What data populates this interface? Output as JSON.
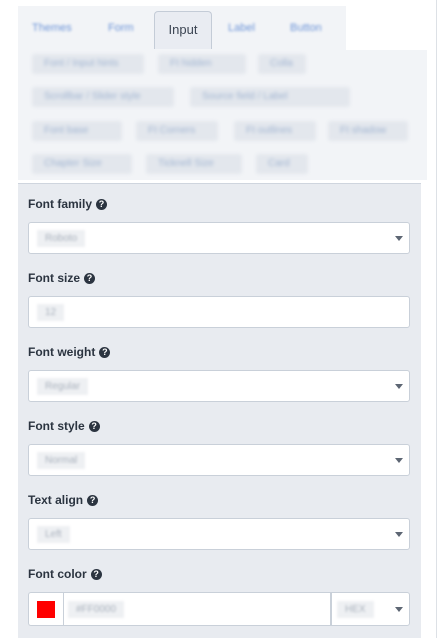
{
  "tabs": [
    {
      "label": "Themes"
    },
    {
      "label": "Form"
    },
    {
      "label": "Input"
    },
    {
      "label": "Label"
    },
    {
      "label": "Button"
    }
  ],
  "property_chips": [
    "Font / Input hints",
    "Ft hidden",
    "Colla",
    "Scrollbar / Slider style",
    "Source field / Label",
    "Font base",
    "Ft Corners",
    "Ft outlines",
    "Ft shadow",
    "Chapter Size",
    "Ticknell Size",
    "Card"
  ],
  "fields": {
    "font_family": {
      "label": "Font family",
      "value": "Roboto"
    },
    "font_size": {
      "label": "Font size",
      "value": "12"
    },
    "font_weight": {
      "label": "Font weight",
      "value": "Regular"
    },
    "font_style": {
      "label": "Font style",
      "value": "Normal"
    },
    "text_align": {
      "label": "Text align",
      "value": "Left"
    },
    "font_color": {
      "label": "Font color",
      "value": "#FF0000",
      "format": "HEX",
      "swatch_color": "#ff0000"
    }
  },
  "help_glyph": "?",
  "colors": {
    "tab_inactive": "#6f96d8",
    "panel": "#e8ebf0",
    "label": "#2b3440"
  }
}
